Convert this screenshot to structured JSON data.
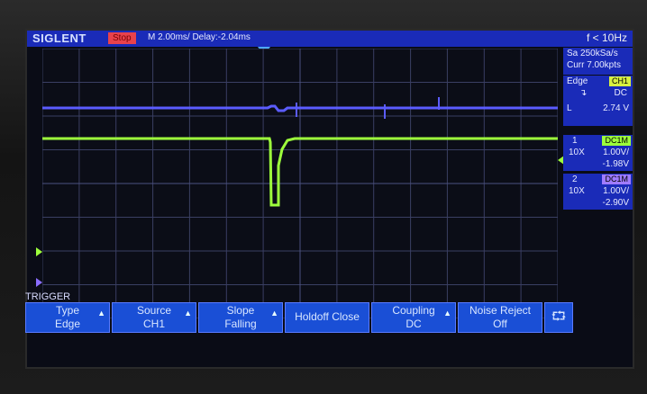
{
  "header": {
    "brand": "SIGLENT",
    "run_state": "Stop",
    "timebase": "M 2.00ms/ Delay:-2.04ms",
    "frequency": "f < 10Hz"
  },
  "acquisition": {
    "sample_rate": "Sa 250kSa/s",
    "memory": "Curr 7.00kpts"
  },
  "trigger_panel": {
    "type": "Edge",
    "source": "CH1",
    "coupling": "DC",
    "level_label": "L",
    "level_value": "2.74 V"
  },
  "channel1": {
    "index": "1",
    "coupling_tag": "DC1M",
    "probe": "10X",
    "scale": "1.00V/",
    "offset": "-1.98V",
    "color": "#9dff3c"
  },
  "channel2": {
    "index": "2",
    "coupling_tag": "DC1M",
    "probe": "10X",
    "scale": "1.00V/",
    "offset": "-2.90V",
    "color": "#8a6dff"
  },
  "menu": {
    "title": "TRIGGER",
    "buttons": [
      {
        "name": "Type",
        "value": "Edge"
      },
      {
        "name": "Source",
        "value": "CH1"
      },
      {
        "name": "Slope",
        "value": "Falling"
      },
      {
        "name": "Holdoff Close",
        "value": ""
      },
      {
        "name": "Coupling",
        "value": "DC"
      },
      {
        "name": "Noise Reject",
        "value": "Off"
      }
    ]
  },
  "icons": [
    "usb-icon",
    "trigger-slope-icon"
  ]
}
